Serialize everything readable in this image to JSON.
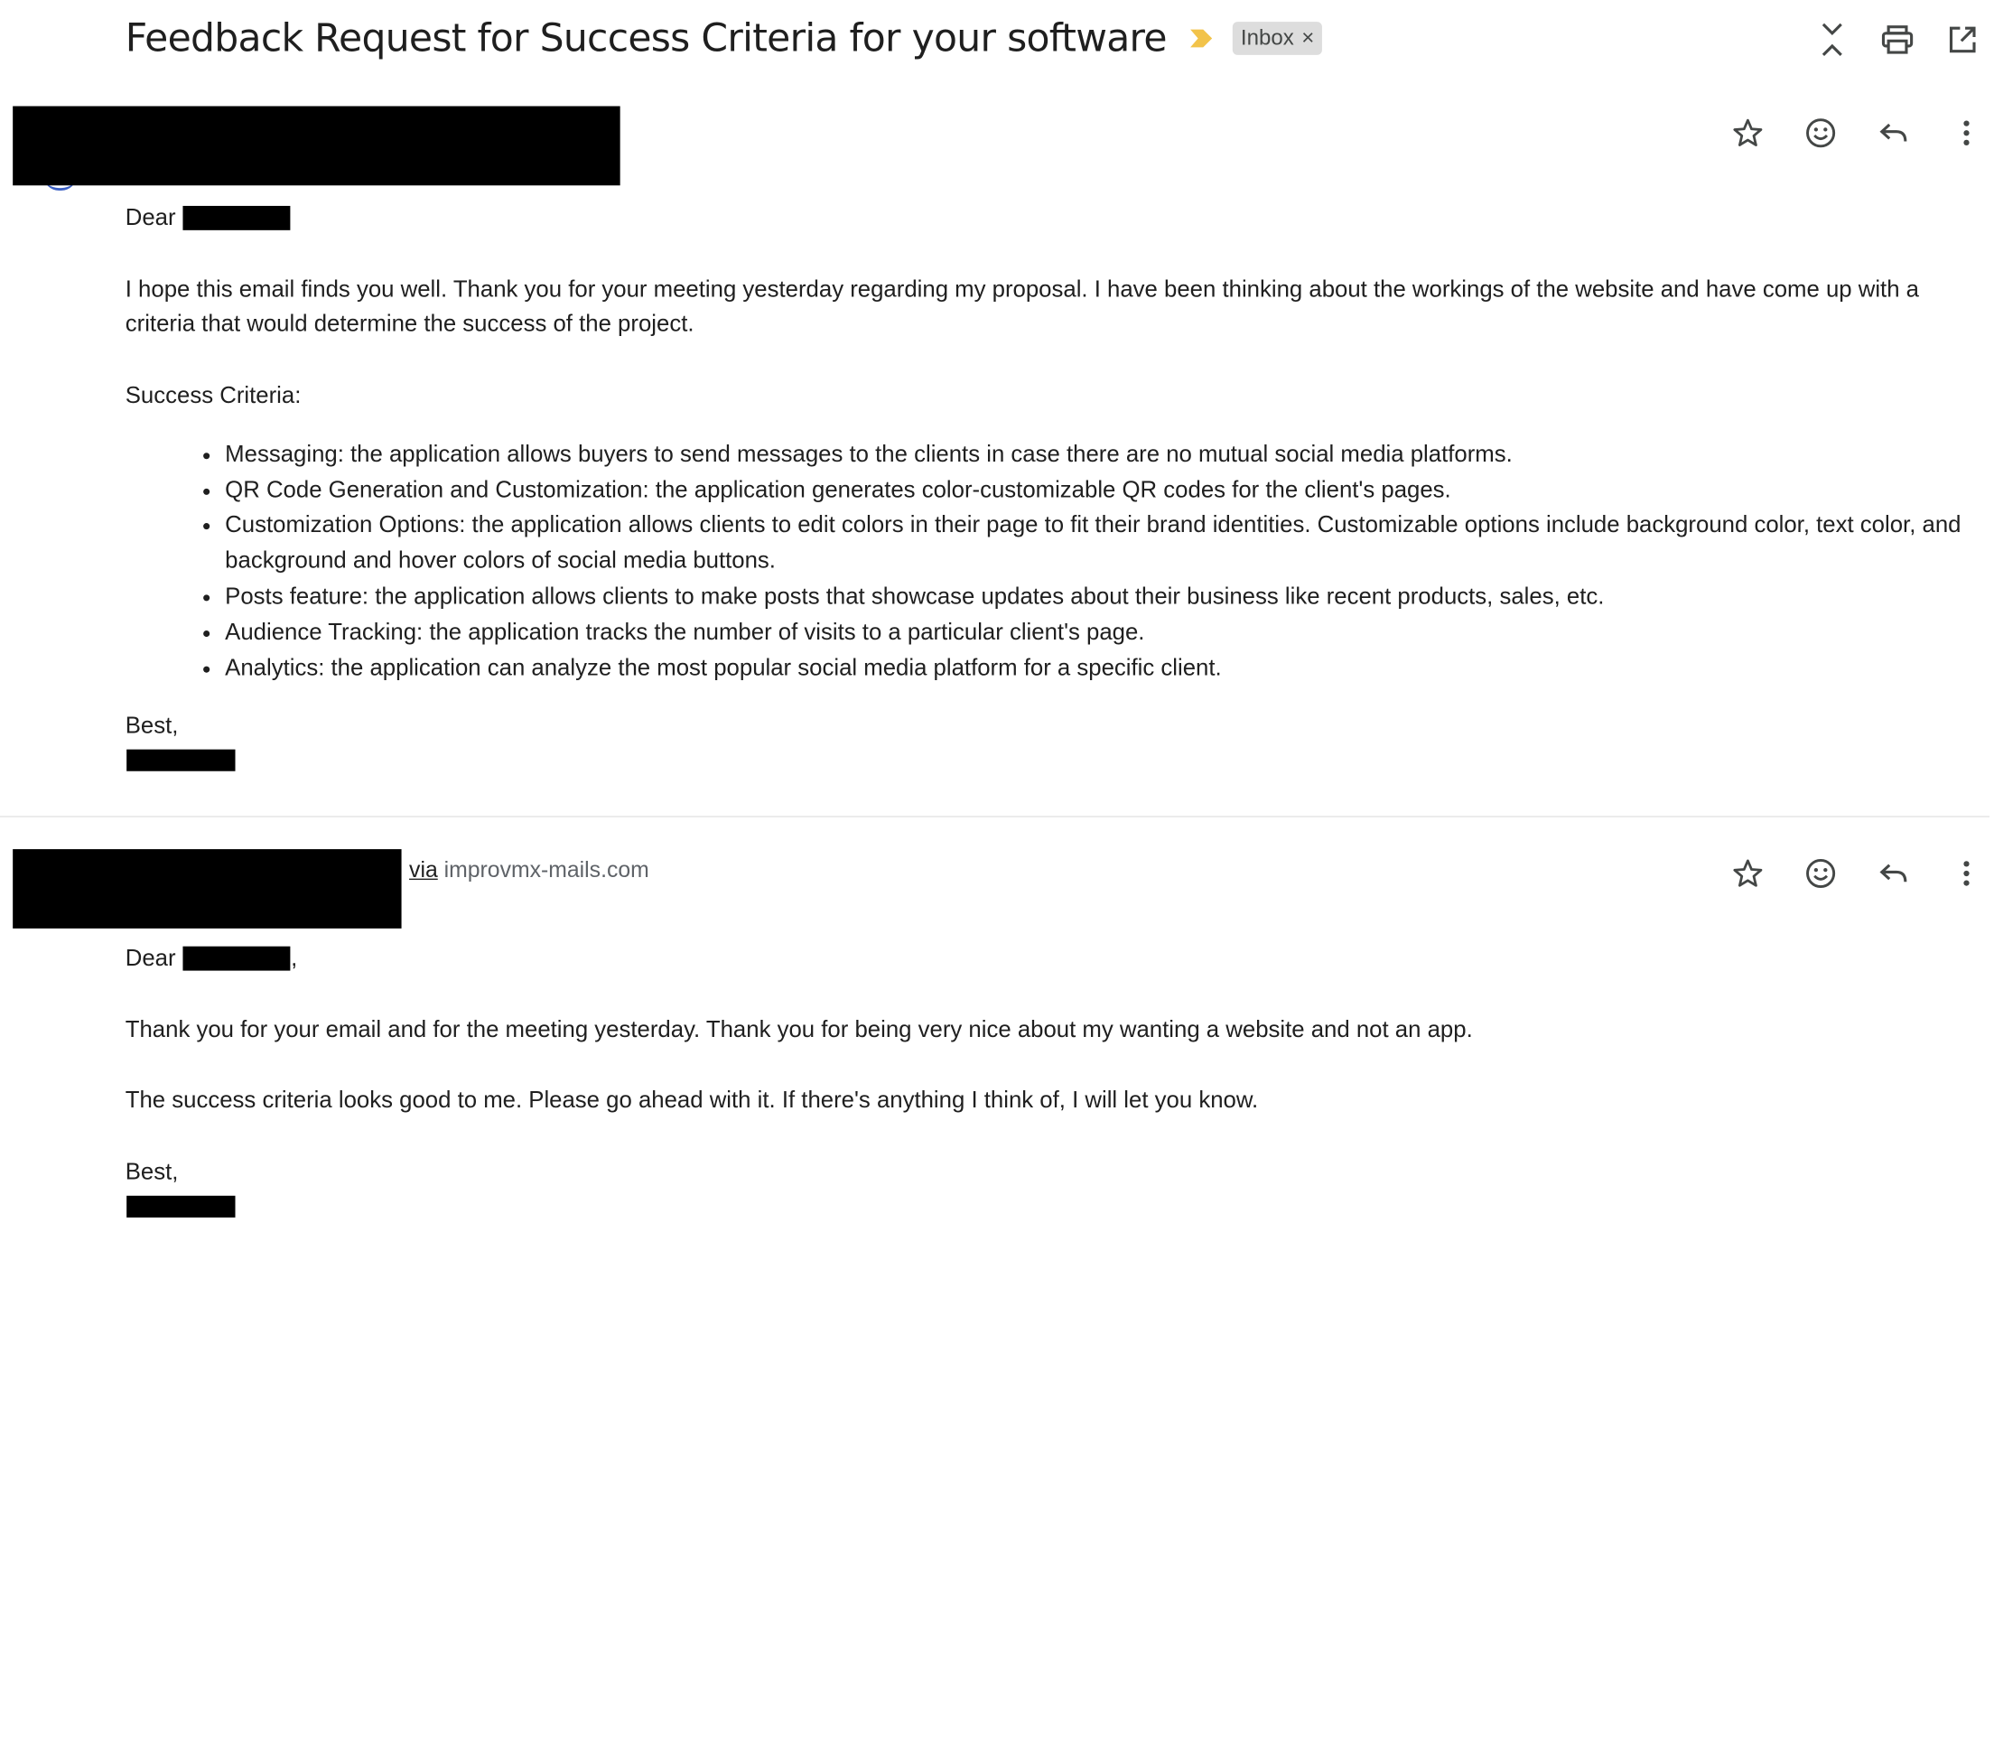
{
  "thread": {
    "subject": "Feedback Request for Success Criteria for your software",
    "importance_color": "#f2c34a",
    "label": "Inbox",
    "label_remove": "×"
  },
  "top_actions": {
    "icons": [
      "collapse-all-icon",
      "print-icon",
      "open-in-new-window-icon"
    ]
  },
  "message1": {
    "greeting": "Dear",
    "greeting_suffix": ",",
    "paragraph1": "I hope this email finds you well. Thank you for your meeting yesterday regarding my proposal. I have been thinking about the workings of the website and have come up with a criteria that would determine the success of the project.",
    "criteria_heading": "Success Criteria:",
    "criteria": [
      "Messaging: the application allows buyers to send messages to the clients in case there are no mutual social media platforms.",
      "QR Code Generation and Customization: the application generates color-customizable QR codes for the client's pages.",
      "Customization Options: the application allows clients to edit colors in their page to fit their brand identities. Customizable options include background color, text color, and background and hover colors of social media buttons.",
      "Posts feature: the application allows clients to make posts that showcase updates about their business like recent products, sales, etc.",
      "Audience Tracking: the application tracks the number of visits to a particular client's page.",
      "Analytics: the application can analyze the most popular social media platform for a specific client."
    ],
    "signoff": "Best,",
    "actions": [
      "star-icon",
      "emoji-reaction-icon",
      "reply-icon",
      "more-vertical-icon"
    ]
  },
  "message2": {
    "via_label": "via",
    "via_domain": "improvmx-mails.com",
    "greeting": "Dear",
    "greeting_suffix": ",",
    "paragraph1": "Thank you for your email and for the meeting yesterday. Thank you for being very nice about my wanting a website and not an app.",
    "paragraph2": "The success criteria looks good to me. Please go ahead with it. If there's anything I think of, I will let you know.",
    "signoff": "Best,",
    "actions": [
      "star-icon",
      "emoji-reaction-icon",
      "reply-icon",
      "more-vertical-icon"
    ]
  }
}
